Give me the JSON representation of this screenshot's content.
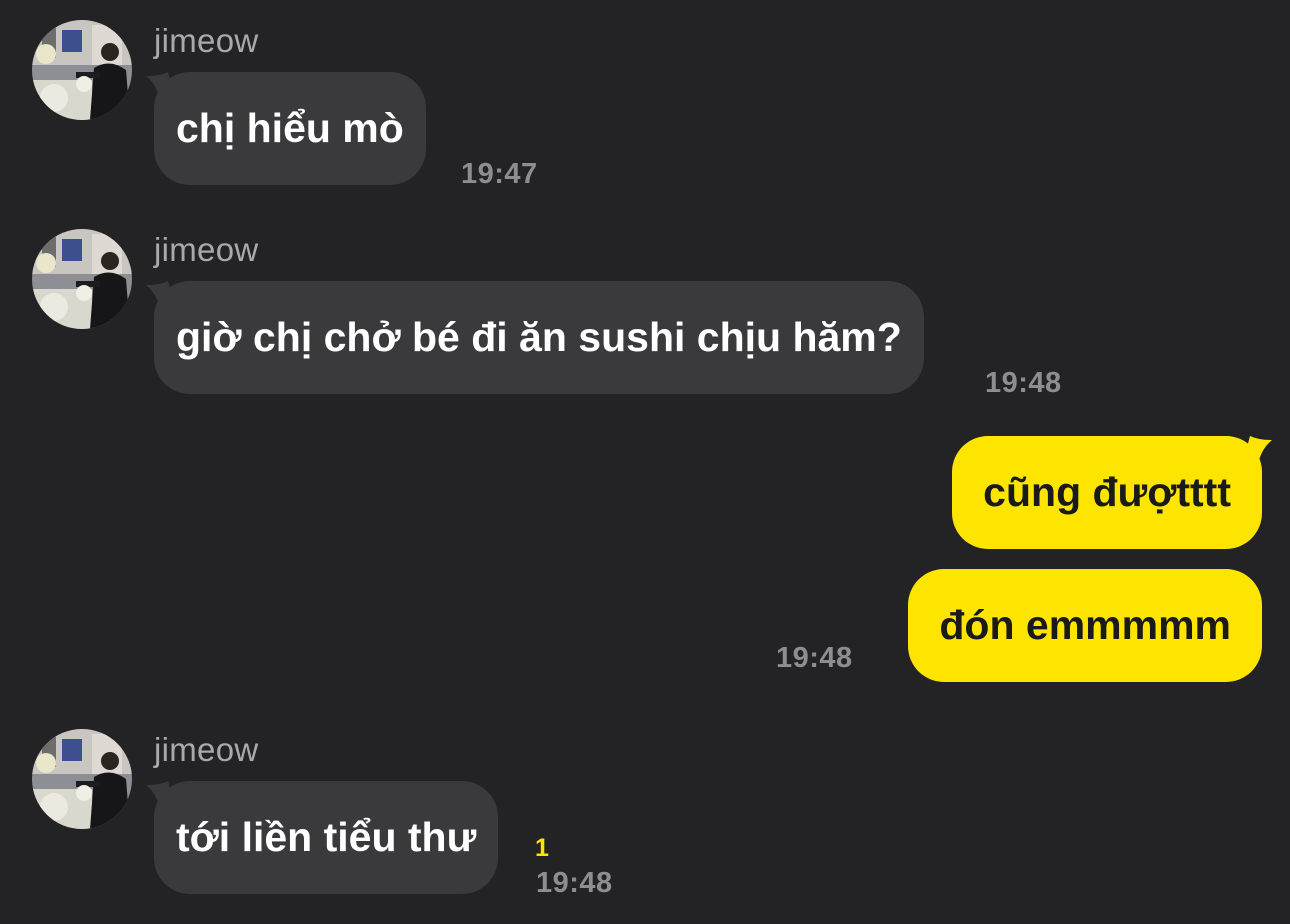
{
  "colors": {
    "background": "#232325",
    "incoming_bubble": "#3a3a3d",
    "outgoing_bubble": "#fee500",
    "timestamp": "#8d8d92",
    "unread": "#fee500"
  },
  "messages": [
    {
      "sender": "jimeow",
      "text": "chị hiểu mò",
      "time": "19:47"
    },
    {
      "sender": "jimeow",
      "text": "giờ chị chở bé đi ăn sushi chịu hăm?",
      "time": "19:48"
    },
    {
      "text": "cũng đượtttt"
    },
    {
      "text": "đón emmmmm",
      "time": "19:48"
    },
    {
      "sender": "jimeow",
      "text": "tới liền tiểu thư",
      "time": "19:48",
      "unread": "1"
    }
  ],
  "avatar_icon": "profile-photo"
}
